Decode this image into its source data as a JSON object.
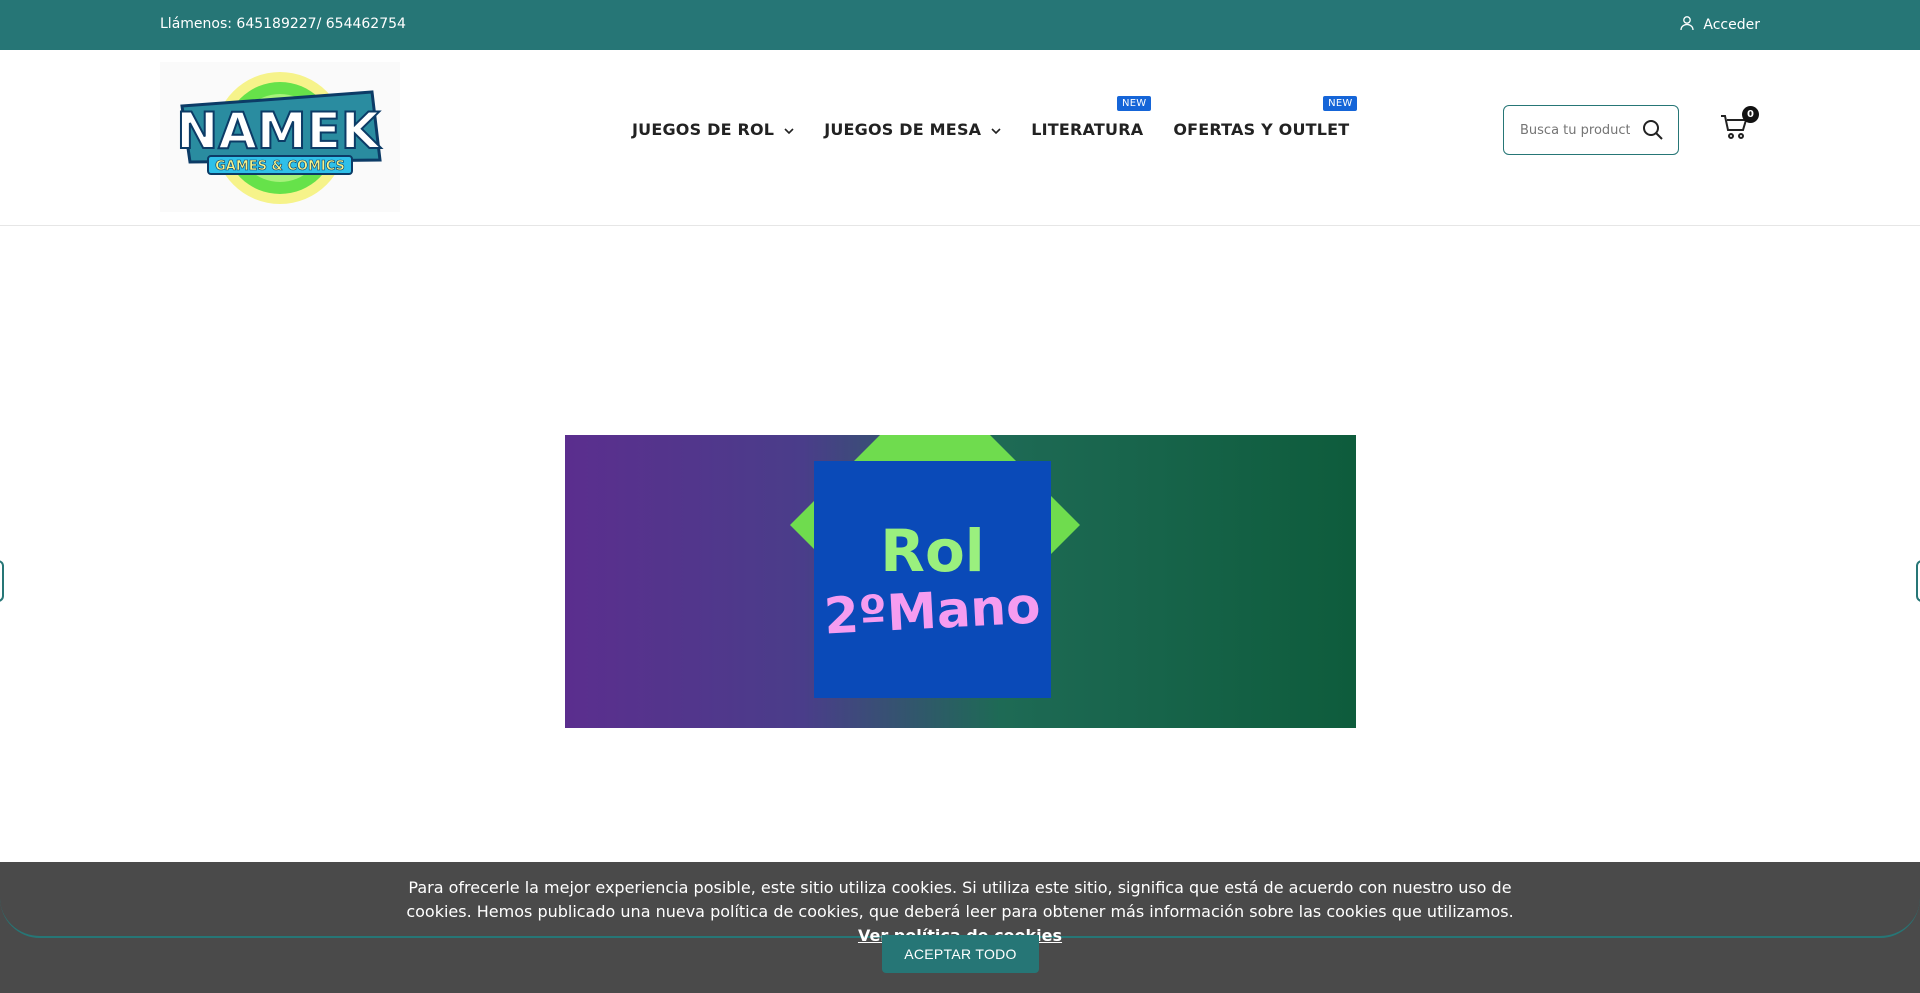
{
  "topbar": {
    "phone_text": "Llámenos: 645189227/ 654462754",
    "login_label": "Acceder",
    "login_icon": "user-icon"
  },
  "header": {
    "logo": {
      "text_main": "NAMEK",
      "text_sub": "GAMES & COMICS"
    },
    "nav": [
      {
        "label": "JUEGOS DE ROL",
        "has_dropdown": true,
        "badge": ""
      },
      {
        "label": "JUEGOS DE MESA",
        "has_dropdown": true,
        "badge": ""
      },
      {
        "label": "LITERATURA",
        "has_dropdown": false,
        "badge": "NEW"
      },
      {
        "label": "OFERTAS Y OUTLET",
        "has_dropdown": false,
        "badge": "NEW"
      }
    ],
    "search": {
      "placeholder": "Busca tu producto",
      "icon": "search-icon"
    },
    "cart": {
      "count": "0",
      "icon": "cart-icon"
    }
  },
  "banner": {
    "line1": "Rol",
    "line2": "2ºMano"
  },
  "cookie": {
    "message": "Para ofrecerle la mejor experiencia posible, este sitio utiliza cookies. Si utiliza este sitio, significa que está de acuerdo con nuestro uso de cookies. Hemos publicado una nueva política de cookies, que deberá leer para obtener más información sobre las cookies que utilizamos. ",
    "policy_link": "Ver política de cookies",
    "accept_label": "ACEPTAR TODO"
  },
  "colors": {
    "brand_teal": "#267676",
    "badge_blue": "#1565d8",
    "cookie_bg": "#4a4a4a"
  }
}
